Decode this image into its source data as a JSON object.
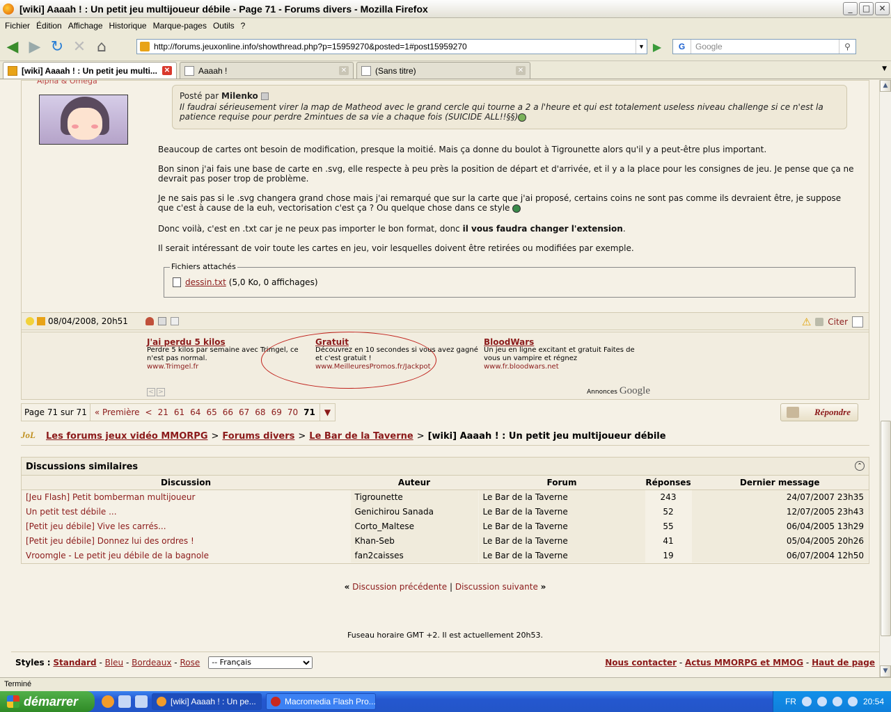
{
  "window": {
    "title": "[wiki] Aaaah ! : Un petit jeu multijoueur débile - Page 71 - Forums divers - Mozilla Firefox"
  },
  "menu": [
    "Fichier",
    "Édition",
    "Affichage",
    "Historique",
    "Marque-pages",
    "Outils",
    "?"
  ],
  "nav": {
    "url": "http://forums.jeuxonline.info/showthread.php?p=15959270&posted=1#post15959270",
    "search_placeholder": "Google"
  },
  "tabs": [
    {
      "label": "[wiki] Aaaah ! : Un petit jeu multi..."
    },
    {
      "label": "Aaaah !"
    },
    {
      "label": "(Sans titre)"
    }
  ],
  "post": {
    "user_title": "Alpha & Omega",
    "quote_by_prefix": "Posté par",
    "quote_by_name": "Milenko",
    "quote_text": "Il faudrai sérieusement virer la map de Matheod avec le grand cercle qui tourne a 2 a l'heure et qui est totalement useless niveau challenge si ce n'est la patience requise pour perdre 2mintues de sa vie a chaque fois (SUICIDE ALL!!§§)",
    "p1": "Beaucoup de cartes ont besoin de modification, presque la moitié. Mais ça donne du boulot à Tigrounette alors qu'il y a peut-être plus important.",
    "p2": "Bon sinon j'ai fais une base de carte en .svg, elle respecte à peu près la position de départ et d'arrivée, et il y a la place pour les consignes de jeu. Je pense que ça ne devrait pas poser trop de problème.",
    "p3": "Je ne sais pas si le .svg changera grand chose mais j'ai remarqué que sur la carte que j'ai proposé, certains coins ne sont pas comme ils devraient être, je suppose que c'est à cause de la euh, vectorisation c'est ça ? Ou quelque chose dans ce style",
    "p4_a": "Donc voilà, c'est en .txt car je ne peux pas importer le bon format, donc ",
    "p4_b": "il vous faudra changer l'extension",
    "p5": "Il serait intéressant de voir toute les cartes en jeu, voir lesquelles doivent être retirées ou modifiées par exemple.",
    "attach_legend": "Fichiers attachés",
    "attach_file": "dessin.txt",
    "attach_info": "(5,0 Ko, 0 affichages)",
    "date": "08/04/2008, 20h51",
    "quote_btn": "Citer"
  },
  "ads": [
    {
      "title": "J'ai perdu 5 kilos",
      "text": "Perdre 5 kilos par semaine avec Trimgel, ce n'est pas normal.",
      "url": "www.Trimgel.fr"
    },
    {
      "title": "Gratuit",
      "text": "Découvrez en 10 secondes si vous avez gagné et c'est gratuit !",
      "url": "www.MeilleuresPromos.fr/Jackpot"
    },
    {
      "title": "BloodWars",
      "text": "Un jeu en ligne excitant et gratuit Faites de vous un vampire et régnez",
      "url": "www.fr.bloodwars.net"
    }
  ],
  "ads_label": "Annonces",
  "ads_brand": "Google",
  "pager": {
    "label": "Page 71 sur 71",
    "first": "« Première",
    "prev": "<",
    "pages": [
      "21",
      "61",
      "64",
      "65",
      "66",
      "67",
      "68",
      "69",
      "70"
    ],
    "current": "71"
  },
  "reply_btn": "Répondre",
  "breadcrumb": {
    "root": "Les forums jeux vidéo MMORPG",
    "l2": "Forums divers",
    "l3": "Le Bar de la Taverne",
    "current": "[wiki] Aaaah ! : Un petit jeu multijoueur débile",
    "sep": ">"
  },
  "similar": {
    "title": "Discussions similaires",
    "headers": [
      "Discussion",
      "Auteur",
      "Forum",
      "Réponses",
      "Dernier message"
    ],
    "rows": [
      [
        "[Jeu Flash] Petit bomberman multijoueur",
        "Tigrounette",
        "Le Bar de la Taverne",
        "243",
        "24/07/2007 23h35"
      ],
      [
        "Un petit test débile ...",
        "Genichirou Sanada",
        "Le Bar de la Taverne",
        "52",
        "12/07/2005 23h43"
      ],
      [
        "[Petit jeu débile] Vive les carrés...",
        "Corto_Maltese",
        "Le Bar de la Taverne",
        "55",
        "06/04/2005 13h29"
      ],
      [
        "[Petit jeu débile] Donnez lui des ordres !",
        "Khan-Seb",
        "Le Bar de la Taverne",
        "41",
        "05/04/2005 20h26"
      ],
      [
        "Vroomgle - Le petit jeu débile de la bagnole",
        "fan2caisses",
        "Le Bar de la Taverne",
        "19",
        "06/07/2004 12h50"
      ]
    ]
  },
  "threadnav": {
    "prev": "Discussion précédente",
    "next": "Discussion suivante",
    "sep": "|",
    "open": "«",
    "close": "»"
  },
  "timezone": "Fuseau horaire GMT +2. Il est actuellement 20h53.",
  "footer": {
    "styles_label": "Styles :",
    "styles": [
      "Standard",
      "Bleu",
      "Bordeaux",
      "Rose"
    ],
    "lang": "-- Français",
    "links": [
      "Nous contacter",
      "Actus MMORPG et MMOG",
      "Haut de page"
    ]
  },
  "status": "Terminé",
  "taskbar": {
    "start": "démarrer",
    "tasks": [
      "[wiki] Aaaah ! : Un pe...",
      "Macromedia Flash Pro..."
    ],
    "lang": "FR",
    "clock": "20:54"
  }
}
